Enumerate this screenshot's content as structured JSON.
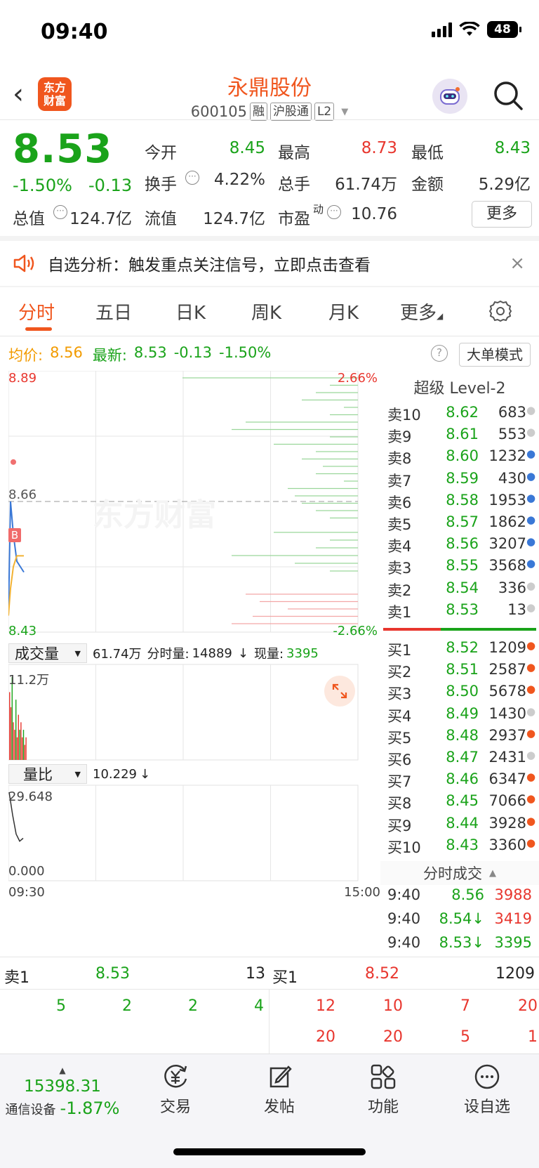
{
  "status": {
    "time": "09:40",
    "battery": "48"
  },
  "header": {
    "logo_line1": "东方",
    "logo_line2": "财富",
    "title": "永鼎股份",
    "code": "600105",
    "tags": [
      "融",
      "沪股通",
      "L2"
    ]
  },
  "quote": {
    "price": "8.53",
    "pct": "-1.50%",
    "change": "-0.13",
    "fields": [
      {
        "label": "今开",
        "value": "8.45",
        "color": "green"
      },
      {
        "label": "最高",
        "value": "8.73",
        "color": "red"
      },
      {
        "label": "最低",
        "value": "8.43",
        "color": "green"
      },
      {
        "label": "换手",
        "value": "4.22%",
        "color": "dark"
      },
      {
        "label": "总手",
        "value": "61.74万",
        "color": "dark"
      },
      {
        "label": "金额",
        "value": "5.29亿",
        "color": "dark"
      },
      {
        "label": "总值",
        "value": "124.7亿",
        "color": "dark"
      },
      {
        "label": "流值",
        "value": "124.7亿",
        "color": "dark"
      },
      {
        "label": "市盈",
        "value": "10.76",
        "color": "dark"
      }
    ],
    "pe_sup": "动",
    "more_label": "更多"
  },
  "banner": {
    "text": "自选分析：触发重点关注信号，立即点击查看"
  },
  "tabs": [
    "分时",
    "五日",
    "日K",
    "周K",
    "月K",
    "更多"
  ],
  "info": {
    "avg_label": "均价:",
    "avg_value": "8.56",
    "latest_label": "最新:",
    "latest_value": "8.53",
    "change": "-0.13",
    "pct": "-1.50%",
    "mode_button": "大单模式"
  },
  "chart": {
    "price_high": "8.89",
    "pct_high": "2.66%",
    "price_mid": "8.66",
    "price_low": "8.43",
    "pct_low": "-2.66%",
    "watermark": "东方财富",
    "b_marker": "B",
    "volume_dropdown": "成交量",
    "volume_total": "61.74万",
    "minute_vol_label": "分时量:",
    "minute_vol_value": "14889",
    "minute_vol_arrow": "↓",
    "current_vol_label": "现量:",
    "current_vol_value": "3395",
    "vol_max": "11.2万",
    "ratio_dropdown": "量比",
    "ratio_value": "10.229",
    "ratio_arrow": "↓",
    "ratio_max": "29.648",
    "ratio_min": "0.000",
    "time_start": "09:30",
    "time_end": "15:00"
  },
  "chart_data": {
    "type": "line",
    "title": "",
    "ylim": [
      8.43,
      8.89
    ],
    "reference_price": 8.66,
    "series": [
      {
        "values": [
          8.45,
          8.66,
          8.6,
          8.55,
          8.53
        ]
      },
      {
        "values": [
          8.45,
          8.5,
          8.54,
          8.56,
          8.56
        ]
      }
    ],
    "volume": [
      9,
      7,
      11,
      5,
      4,
      8,
      3,
      6,
      4,
      5,
      3,
      4,
      2,
      3
    ],
    "volume_ratio": [
      29.648,
      20,
      12,
      9,
      10.229
    ]
  },
  "orderbook": {
    "title": "超级 Level-2",
    "asks": [
      {
        "name": "卖10",
        "price": "8.62",
        "vol": "683",
        "dot": "#cccccc"
      },
      {
        "name": "卖9",
        "price": "8.61",
        "vol": "553",
        "dot": "#cccccc"
      },
      {
        "name": "卖8",
        "price": "8.60",
        "vol": "1232",
        "dot": "#3a78d6"
      },
      {
        "name": "卖7",
        "price": "8.59",
        "vol": "430",
        "dot": "#3a78d6"
      },
      {
        "name": "卖6",
        "price": "8.58",
        "vol": "1953",
        "dot": "#3a78d6"
      },
      {
        "name": "卖5",
        "price": "8.57",
        "vol": "1862",
        "dot": "#3a78d6"
      },
      {
        "name": "卖4",
        "price": "8.56",
        "vol": "3207",
        "dot": "#3a78d6"
      },
      {
        "name": "卖3",
        "price": "8.55",
        "vol": "3568",
        "dot": "#3a78d6"
      },
      {
        "name": "卖2",
        "price": "8.54",
        "vol": "336",
        "dot": "#cccccc"
      },
      {
        "name": "卖1",
        "price": "8.53",
        "vol": "13",
        "dot": "#cccccc"
      }
    ],
    "bids": [
      {
        "name": "买1",
        "price": "8.52",
        "vol": "1209",
        "dot": "#f0561e"
      },
      {
        "name": "买2",
        "price": "8.51",
        "vol": "2587",
        "dot": "#f0561e"
      },
      {
        "name": "买3",
        "price": "8.50",
        "vol": "5678",
        "dot": "#f0561e"
      },
      {
        "name": "买4",
        "price": "8.49",
        "vol": "1430",
        "dot": "#cccccc"
      },
      {
        "name": "买5",
        "price": "8.48",
        "vol": "2937",
        "dot": "#f0561e"
      },
      {
        "name": "买6",
        "price": "8.47",
        "vol": "2431",
        "dot": "#cccccc"
      },
      {
        "name": "买7",
        "price": "8.46",
        "vol": "6347",
        "dot": "#f0561e"
      },
      {
        "name": "买8",
        "price": "8.45",
        "vol": "7066",
        "dot": "#f0561e"
      },
      {
        "name": "买9",
        "price": "8.44",
        "vol": "3928",
        "dot": "#f0561e"
      },
      {
        "name": "买10",
        "price": "8.43",
        "vol": "3360",
        "dot": "#f0561e"
      }
    ],
    "trades_title": "分时成交",
    "trades": [
      {
        "time": "9:40",
        "price": "8.56",
        "vol": "3988",
        "vcolor": "red"
      },
      {
        "time": "9:40",
        "price": "8.54↓",
        "vol": "3419",
        "vcolor": "red"
      },
      {
        "time": "9:40",
        "price": "8.53↓",
        "vol": "3395",
        "vcolor": "green"
      }
    ]
  },
  "queue": {
    "sell_label": "卖1",
    "sell_price": "8.53",
    "sell_vol": "13",
    "buy_label": "买1",
    "buy_price": "8.52",
    "buy_vol": "1209",
    "sell_orders": [
      "5",
      "2",
      "2",
      "4"
    ],
    "buy_orders_row1": [
      "12",
      "10",
      "7",
      "20"
    ],
    "buy_orders_row2": [
      "20",
      "20",
      "5",
      "1"
    ]
  },
  "tabbar": {
    "index_value": "15398.31",
    "index_name": "通信设备",
    "index_pct": "-1.87%",
    "items": [
      "交易",
      "发帖",
      "功能",
      "设自选"
    ]
  }
}
